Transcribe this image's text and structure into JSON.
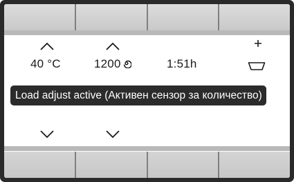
{
  "display": {
    "temperature": "40 °C",
    "spin_speed": "1200",
    "time_remaining": "1:51h",
    "status_message": "Load adjust active (Активен сензор за количество)"
  },
  "icons": {
    "up": "chevron-up-icon",
    "down": "chevron-down-icon",
    "spin": "spin-icon",
    "plus": "plus-icon",
    "detergent": "detergent-tray-icon"
  },
  "colors": {
    "bezel": "#2a2a2a",
    "softkey": "#d0d0d0",
    "banner_bg": "#2b2b2b",
    "banner_text": "#ffffff",
    "text": "#1a1a1a"
  }
}
